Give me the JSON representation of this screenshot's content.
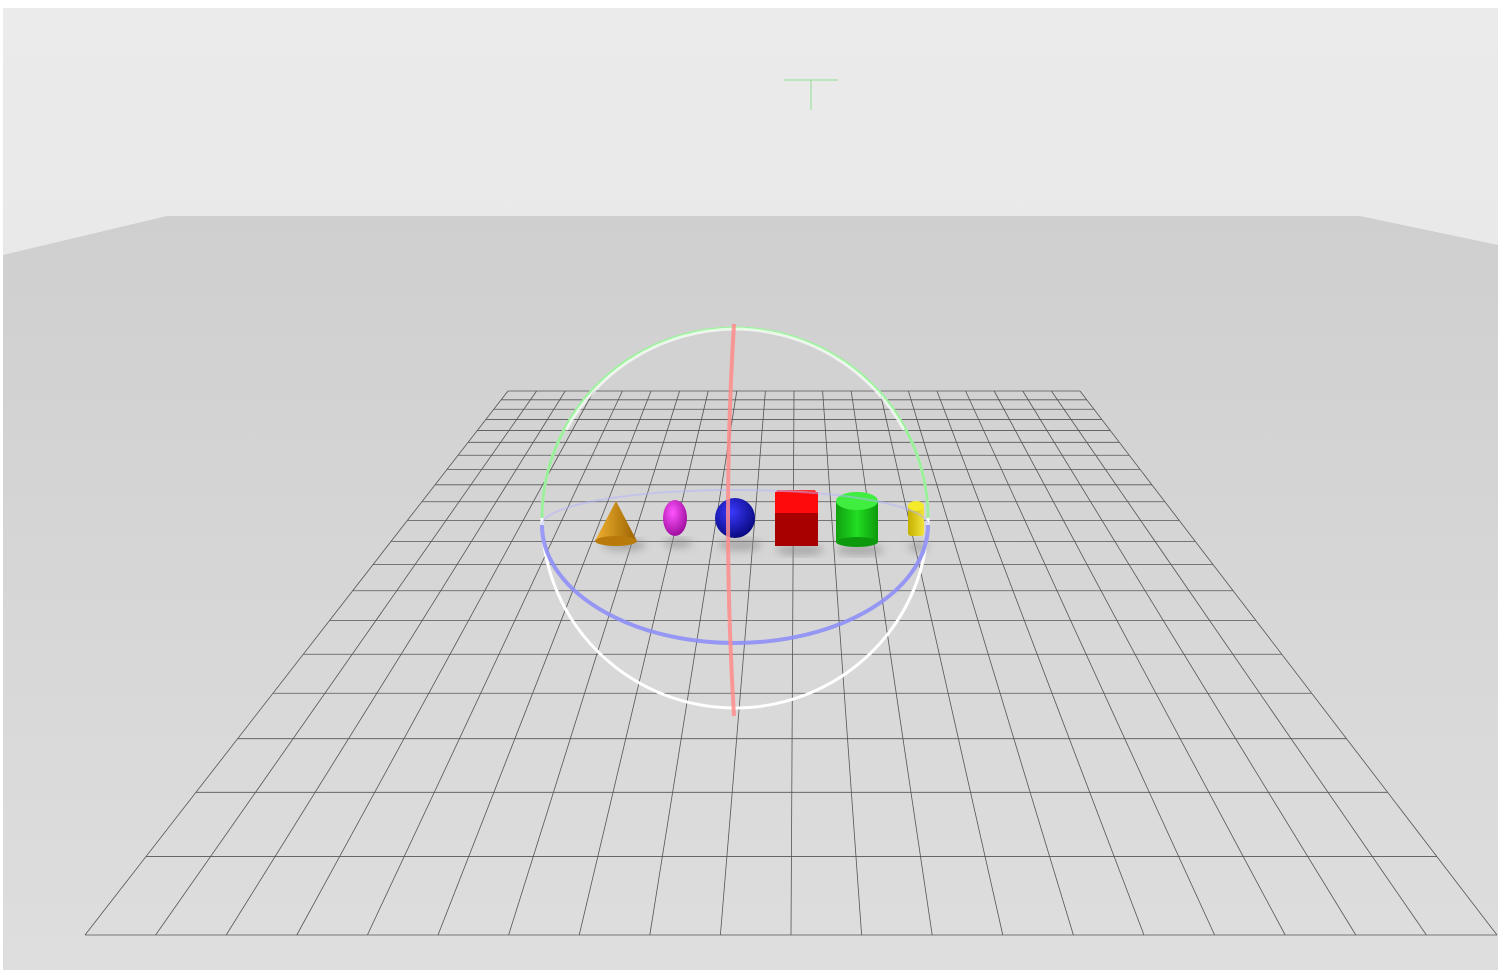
{
  "viewport": {
    "background_wall_color": "#e7e7e7",
    "floor_color": "#d6d6d6",
    "grid": {
      "rows": 20,
      "cols": 20,
      "line_color": "#555555"
    }
  },
  "objects": [
    {
      "name": "cone",
      "shape": "cone",
      "color": "#d4900a"
    },
    {
      "name": "ellipsoid",
      "shape": "ellipsoid",
      "color": "#d822d8"
    },
    {
      "name": "sphere",
      "shape": "sphere",
      "color": "#1414c4"
    },
    {
      "name": "cube",
      "shape": "cube",
      "color": "#ff1111"
    },
    {
      "name": "cylinder",
      "shape": "cylinder",
      "color": "#19d219"
    },
    {
      "name": "capsule",
      "shape": "capsule",
      "color": "#e6d41a"
    }
  ],
  "rotation_gizmo": {
    "x_ring_color": "#ff8f8f",
    "y_ring_color": "#8fff8f",
    "z_ring_color": "#8f8fff",
    "outer_ring_color": "#ffffff"
  },
  "cursor_icon": "crosshair-marker-icon"
}
